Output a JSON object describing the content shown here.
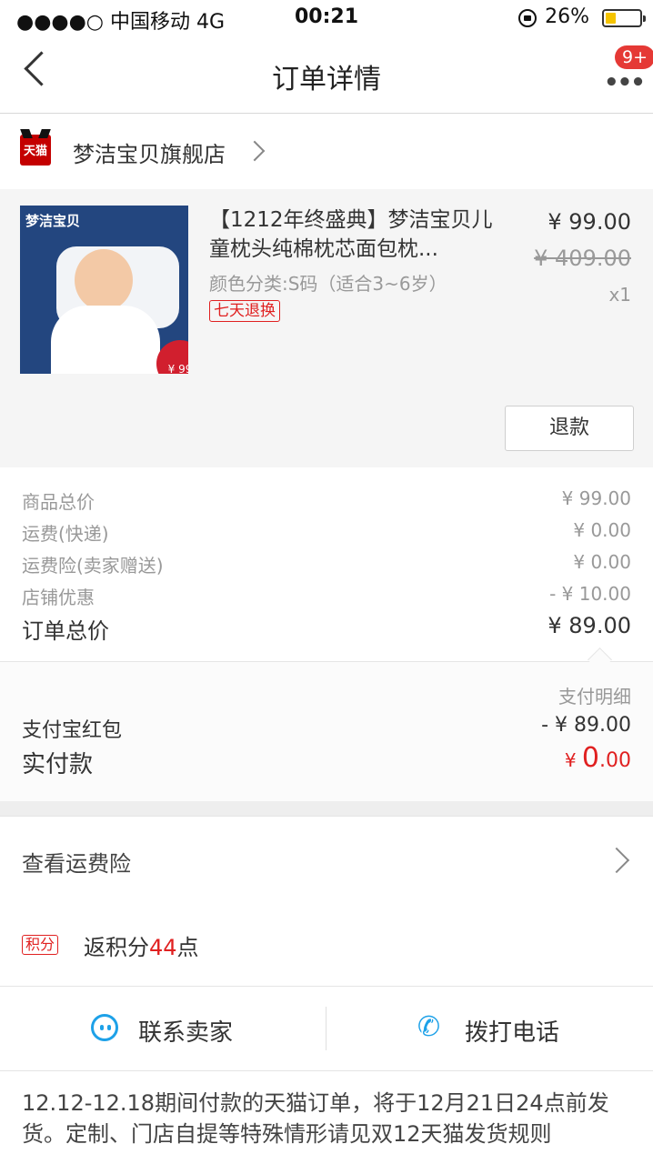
{
  "status_bar": {
    "carrier": "●●●●○ 中国移动  4G",
    "time": "00:21",
    "battery": "26%"
  },
  "nav": {
    "title": "订单详情",
    "badge": "9+"
  },
  "shop": {
    "name": "梦洁宝贝旗舰店",
    "icon_text": "天猫"
  },
  "product": {
    "thumb_brand": "梦洁宝贝",
    "thumb_price": "¥ 99",
    "title": "【1212年终盛典】梦洁宝贝儿童枕头纯棉枕芯面包枕...",
    "variant": "颜色分类:S码（适合3~6岁）",
    "return_tag": "七天退换",
    "price": "¥ 99.00",
    "original_price": "¥ 409.00",
    "qty": "x1",
    "refund_button": "退款"
  },
  "summary": {
    "rows": [
      {
        "label": "商品总价",
        "value": "¥ 99.00"
      },
      {
        "label": "运费(快递)",
        "value": "¥ 0.00"
      },
      {
        "label": "运费险(卖家赠送)",
        "value": "¥ 0.00"
      },
      {
        "label": "店铺优惠",
        "value": "- ¥ 10.00"
      }
    ],
    "total_label": "订单总价",
    "total_value": "¥ 89.00"
  },
  "payment": {
    "detail_label": "支付明细",
    "hongbao_label": "支付宝红包",
    "hongbao_value": "- ¥ 89.00",
    "paid_label": "实付款",
    "paid_currency": "¥ ",
    "paid_int": "0",
    "paid_dec": ".00"
  },
  "insurance": {
    "label": "查看运费险"
  },
  "points": {
    "tag": "积分",
    "prefix": "返积分",
    "number": "44",
    "suffix": "点"
  },
  "contact": {
    "seller": "联系卖家",
    "phone": "拨打电话"
  },
  "notice": "12.12-12.18期间付款的天猫订单，将于12月21日24点前发货。定制、门店自提等特殊情形请见双12天猫发货规则",
  "colors": {
    "accent_red": "#e02020",
    "link_blue": "#1da1e8",
    "tmall_red": "#c40000"
  }
}
